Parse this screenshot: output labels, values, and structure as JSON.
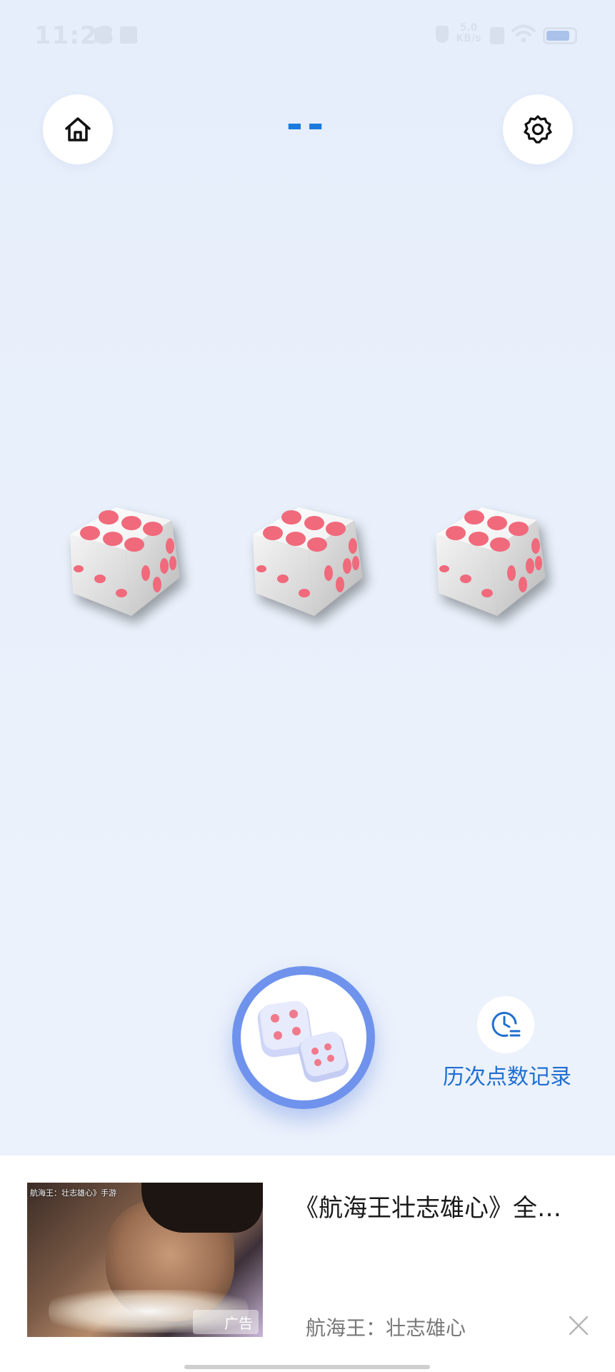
{
  "status_bar": {
    "time": "11:23",
    "net_speed_value": "5.0",
    "net_speed_unit": "KB/s"
  },
  "header": {
    "score_display": "--",
    "home_icon": "home-icon",
    "settings_icon": "gear-icon"
  },
  "dice": {
    "faces_top": [
      6,
      6,
      6
    ],
    "pip_color": "#f06a7c"
  },
  "roll_button": {
    "icon": "dice-pair-icon",
    "ring_color": "#6f93ec"
  },
  "history": {
    "label": "历次点数记录",
    "icon": "clock-list-icon",
    "color": "#1f6fd0"
  },
  "ad": {
    "thumb_caption": "航海王：壮志雄心》手游",
    "tag": "广告",
    "title": "《航海王壮志雄心》全…",
    "subtitle": "航海王：壮志雄心",
    "close_icon": "close-icon"
  }
}
